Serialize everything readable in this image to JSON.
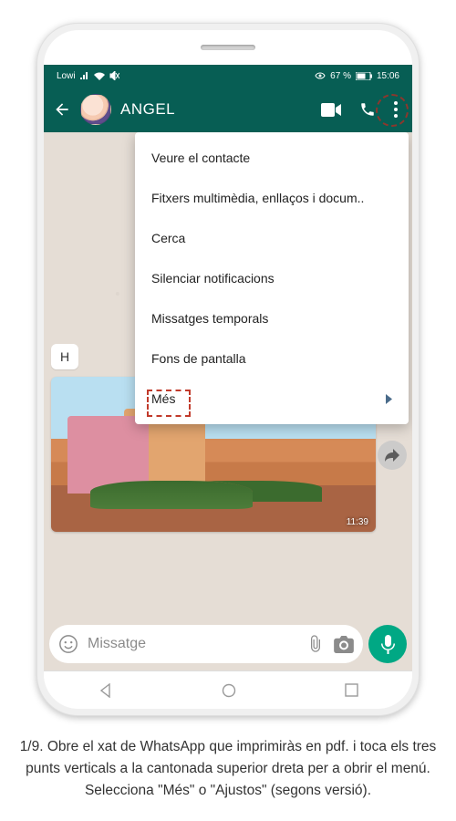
{
  "status": {
    "carrier": "Lowi",
    "battery_pct": "67 %",
    "time": "15:06"
  },
  "chat": {
    "title": "ANGEL",
    "incoming_stub": "H",
    "image_time": "11:39",
    "composer_placeholder": "Missatge"
  },
  "menu": {
    "items": [
      "Veure el contacte",
      "Fitxers multimèdia, enllaços i docum..",
      "Cerca",
      "Silenciar notificacions",
      "Missatges temporals",
      "Fons de pantalla",
      "Més"
    ]
  },
  "caption": {
    "text": "1/9. Obre el xat de WhatsApp que imprimiràs en pdf. i toca els tres punts verticals a la cantonada superior dreta per a obrir el menú. Selecciona \"Més\" o \"Ajustos\" (segons versió)."
  },
  "colors": {
    "primary": "#075e54",
    "accent": "#00a884",
    "highlight": "#c13a2b"
  }
}
